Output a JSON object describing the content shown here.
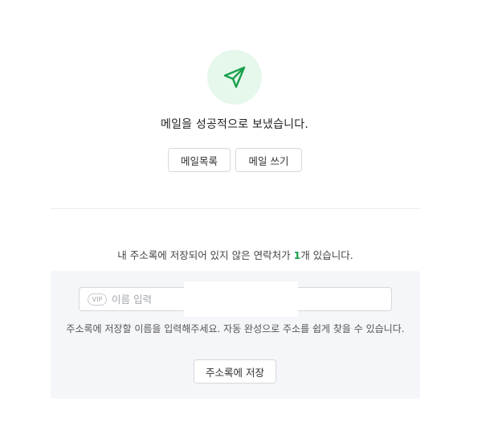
{
  "icons": {
    "status": "paper-plane-icon",
    "vip": "vip-badge",
    "accent_color": "#1aa14c",
    "circle_color": "#e6f7ec"
  },
  "result": {
    "message": "메일을 성공적으로 보냈습니다."
  },
  "actions": {
    "mail_list_label": "메일목록",
    "compose_label": "메일 쓰기"
  },
  "address_book": {
    "notice_prefix": "내 주소록에 저장되어 있지 않은 연락처가 ",
    "count": "1",
    "notice_suffix": "개 있습니다.",
    "vip_label": "VIP",
    "name_placeholder": "이름 입력",
    "name_value": "",
    "hint": "주소록에 저장할 이름을 입력해주세요. 자동 완성으로 주소를 쉽게 찾을 수 있습니다.",
    "save_label": "주소록에 저장"
  }
}
